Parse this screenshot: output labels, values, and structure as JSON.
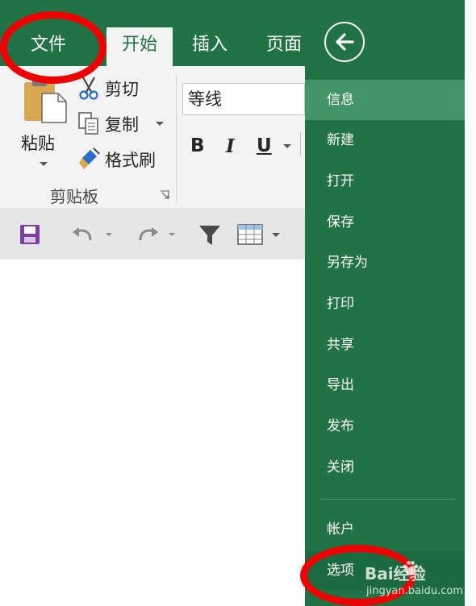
{
  "tabs": {
    "file": "文件",
    "home": "开始",
    "insert": "插入",
    "page": "页面"
  },
  "clipboard": {
    "paste": "粘贴",
    "cut": "剪切",
    "copy": "复制",
    "format_painter": "格式刷",
    "group_label": "剪贴板"
  },
  "font": {
    "name": "等线",
    "bold": "B",
    "italic": "I",
    "underline": "U"
  },
  "backstage": {
    "items": [
      "信息",
      "新建",
      "打开",
      "保存",
      "另存为",
      "打印",
      "共享",
      "导出",
      "发布",
      "关闭"
    ],
    "account": "帐户",
    "options": "选项"
  },
  "watermark": {
    "brand": "Bai经验",
    "url": "jingyan.baidu.com"
  },
  "colors": {
    "excel_green": "#217346",
    "selected_item": "#439467",
    "annotation_red": "#ee0000"
  }
}
